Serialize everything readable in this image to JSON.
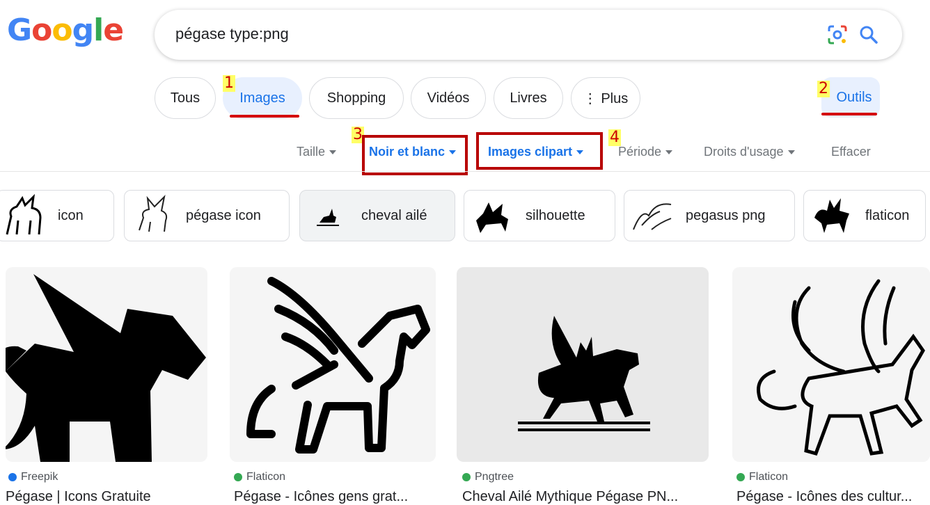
{
  "logo": {
    "letters": [
      "G",
      "o",
      "o",
      "g",
      "l",
      "e"
    ]
  },
  "search": {
    "query": "pégase type:png"
  },
  "nav": {
    "tabs": [
      {
        "label": "Tous"
      },
      {
        "label": "Images"
      },
      {
        "label": "Shopping"
      },
      {
        "label": "Vidéos"
      },
      {
        "label": "Livres"
      },
      {
        "label": "⋮ Plus"
      }
    ],
    "tools_label": "Outils"
  },
  "badges": [
    "1",
    "2",
    "3",
    "4"
  ],
  "tools": {
    "size": "Taille",
    "color": "Noir et blanc",
    "type": "Images clipart",
    "time": "Période",
    "rights": "Droits d'usage",
    "clear": "Effacer"
  },
  "related": [
    "icon",
    "pégase icon",
    "cheval ailé",
    "silhouette",
    "pegasus png",
    "flaticon"
  ],
  "results": [
    {
      "source": "Freepik",
      "title": "Pégase | Icons Gratuite",
      "source_color": "#1a73e8"
    },
    {
      "source": "Flaticon",
      "title": "Pégase - Icônes gens grat...",
      "source_color": "#34a853"
    },
    {
      "source": "Pngtree",
      "title": "Cheval Ailé Mythique Pégase PN...",
      "source_color": "#34a853"
    },
    {
      "source": "Flaticon",
      "title": "Pégase - Icônes des cultur...",
      "source_color": "#34a853"
    }
  ],
  "colors": {
    "accent": "#1a73e8",
    "annotation_red": "#b80000",
    "badge_yellow": "#ffff66"
  }
}
